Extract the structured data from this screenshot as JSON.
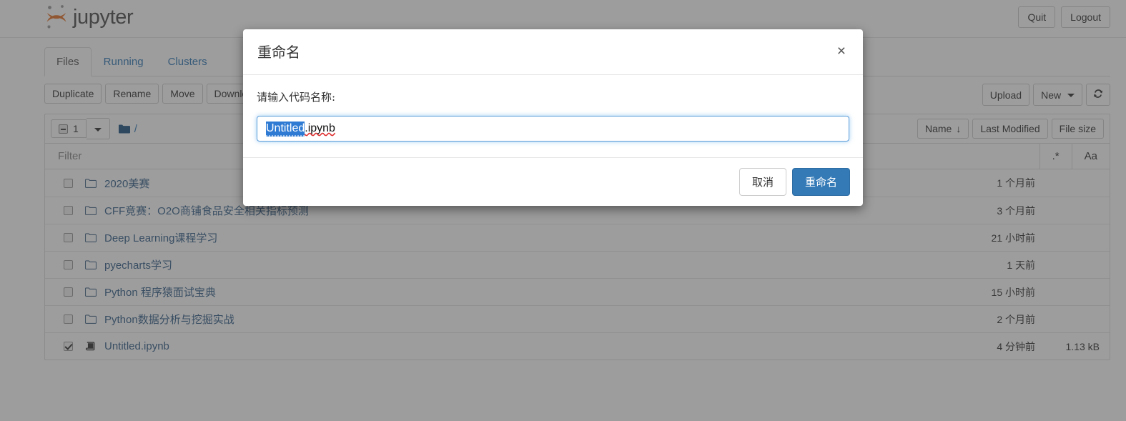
{
  "header": {
    "brand": "jupyter",
    "quit_label": "Quit",
    "logout_label": "Logout"
  },
  "tabs": [
    {
      "label": "Files",
      "active": true
    },
    {
      "label": "Running",
      "active": false
    },
    {
      "label": "Clusters",
      "active": false
    }
  ],
  "toolbar": {
    "left": [
      "Duplicate",
      "Rename",
      "Move",
      "Download"
    ],
    "upload_label": "Upload",
    "new_label": "New",
    "refresh_icon": "refresh-icon"
  },
  "list_toolbar": {
    "select_count": "1",
    "breadcrumb_root": "/",
    "sort_name_label": "Name",
    "sort_name_arrow": "↓",
    "sort_modified_label": "Last Modified",
    "sort_size_label": "File size"
  },
  "filter": {
    "placeholder": "Filter",
    "value": "",
    "regex_toggle": ".*",
    "case_toggle": "Aa"
  },
  "files": [
    {
      "name": "2020美赛",
      "type": "folder",
      "checked": false,
      "modified": "1 个月前",
      "size": ""
    },
    {
      "name": "CFF竞赛：O2O商铺食品安全相关指标预测",
      "type": "folder",
      "checked": false,
      "modified": "3 个月前",
      "size": ""
    },
    {
      "name": "Deep Learning课程学习",
      "type": "folder",
      "checked": false,
      "modified": "21 小时前",
      "size": ""
    },
    {
      "name": "pyecharts学习",
      "type": "folder",
      "checked": false,
      "modified": "1 天前",
      "size": ""
    },
    {
      "name": "Python 程序猿面试宝典",
      "type": "folder",
      "checked": false,
      "modified": "15 小时前",
      "size": ""
    },
    {
      "name": "Python数据分析与挖掘实战",
      "type": "folder",
      "checked": false,
      "modified": "2 个月前",
      "size": ""
    },
    {
      "name": "Untitled.ipynb",
      "type": "notebook",
      "checked": true,
      "modified": "4 分钟前",
      "size": "1.13 kB"
    }
  ],
  "modal": {
    "title": "重命名",
    "close_label": "×",
    "prompt": "请输入代码名称:",
    "input_selected": "Untitled",
    "input_rest": ".ipynb",
    "input_value": "Untitled.ipynb",
    "cancel_label": "取消",
    "confirm_label": "重命名"
  },
  "colors": {
    "brand_orange": "#e57228",
    "link_blue": "#36618b",
    "primary_blue": "#337ab7",
    "selection_blue": "#2f7bd4",
    "backdrop": "#808080"
  }
}
